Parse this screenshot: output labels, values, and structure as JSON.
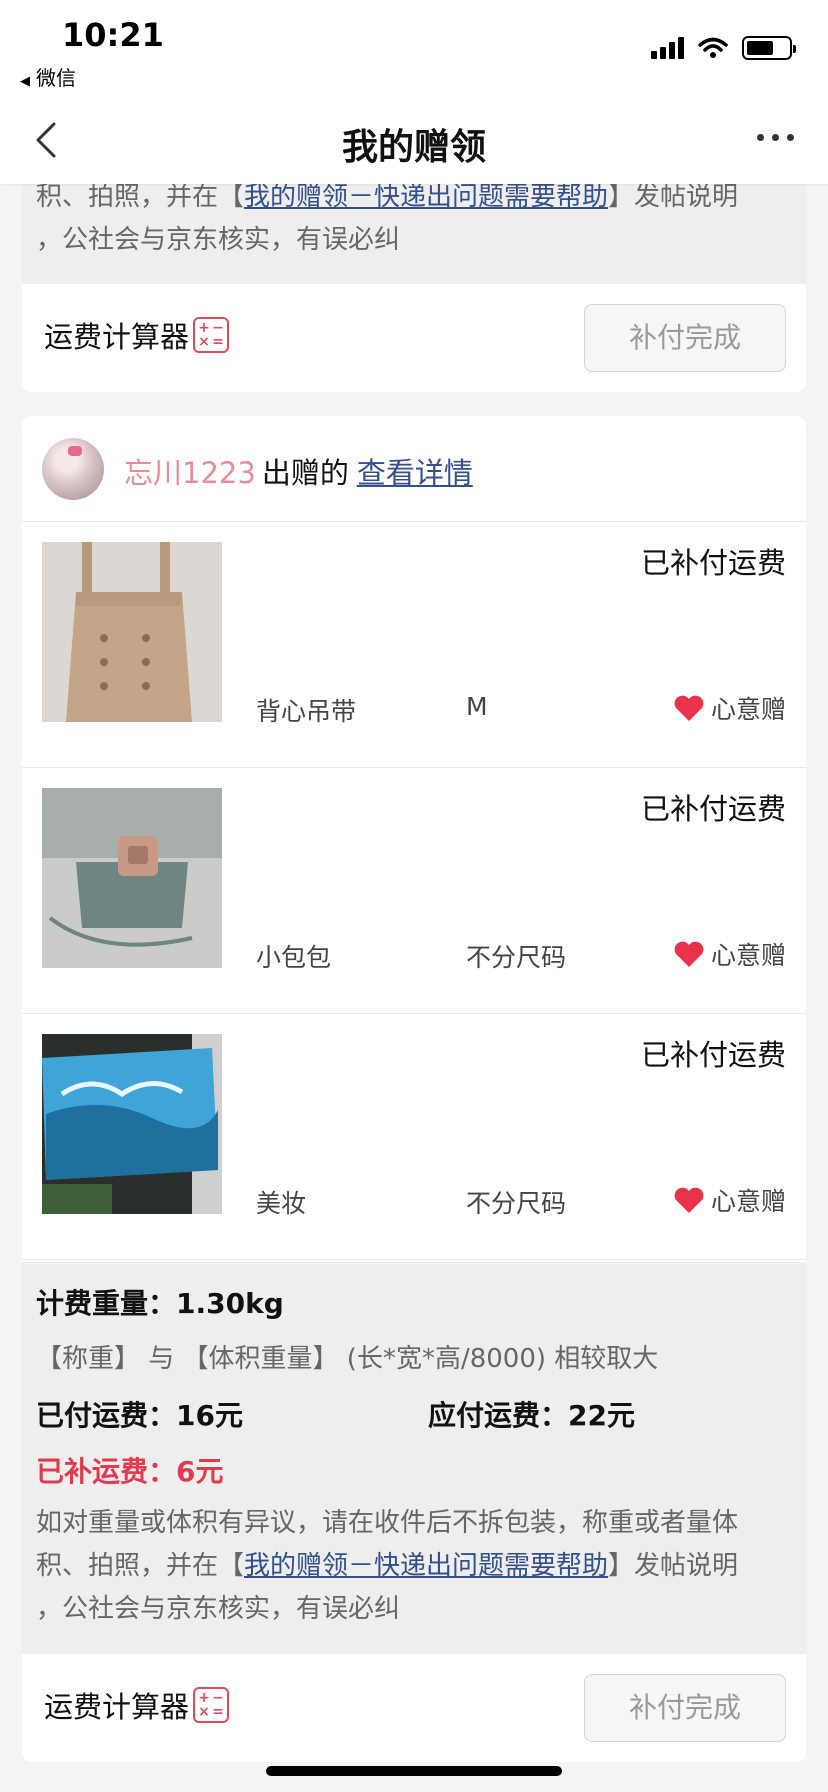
{
  "status_bar": {
    "time": "10:21",
    "back_app": "微信"
  },
  "nav": {
    "title": "我的赠领"
  },
  "notice": {
    "prefix_full": "如对重量或体积有异议，请在收件后不拆包装，称重或者量体",
    "line_prefix": "积、拍照，并在【",
    "link": "我的赠领－快递出问题需要帮助",
    "after_link": "】发帖说明",
    "line_last": "，公社会与京东核实，有误必纠"
  },
  "footer": {
    "calculator_label": "运费计算器",
    "pay_done_label": "补付完成"
  },
  "donor": {
    "name": "忘川1223",
    "label": "出赠的",
    "detail_link": "查看详情"
  },
  "items": [
    {
      "status": "已补付运费",
      "name": "背心吊带",
      "size": "M",
      "tag": "心意赠"
    },
    {
      "status": "已补付运费",
      "name": "小包包",
      "size": "不分尺码",
      "tag": "心意赠"
    },
    {
      "status": "已补付运费",
      "name": "美妆",
      "size": "不分尺码",
      "tag": "心意赠"
    }
  ],
  "summary": {
    "weight": "计费重量：1.30kg",
    "rule": "【称重】 与 【体积重量】 (长*宽*高/8000) 相较取大",
    "paid": "已付运费：16元",
    "due": "应付运费：22元",
    "extra": "已补运费：6元"
  },
  "colors": {
    "accent_red": "#e03c4f",
    "link_blue": "#34508a",
    "donor_pink": "#e48f96"
  }
}
